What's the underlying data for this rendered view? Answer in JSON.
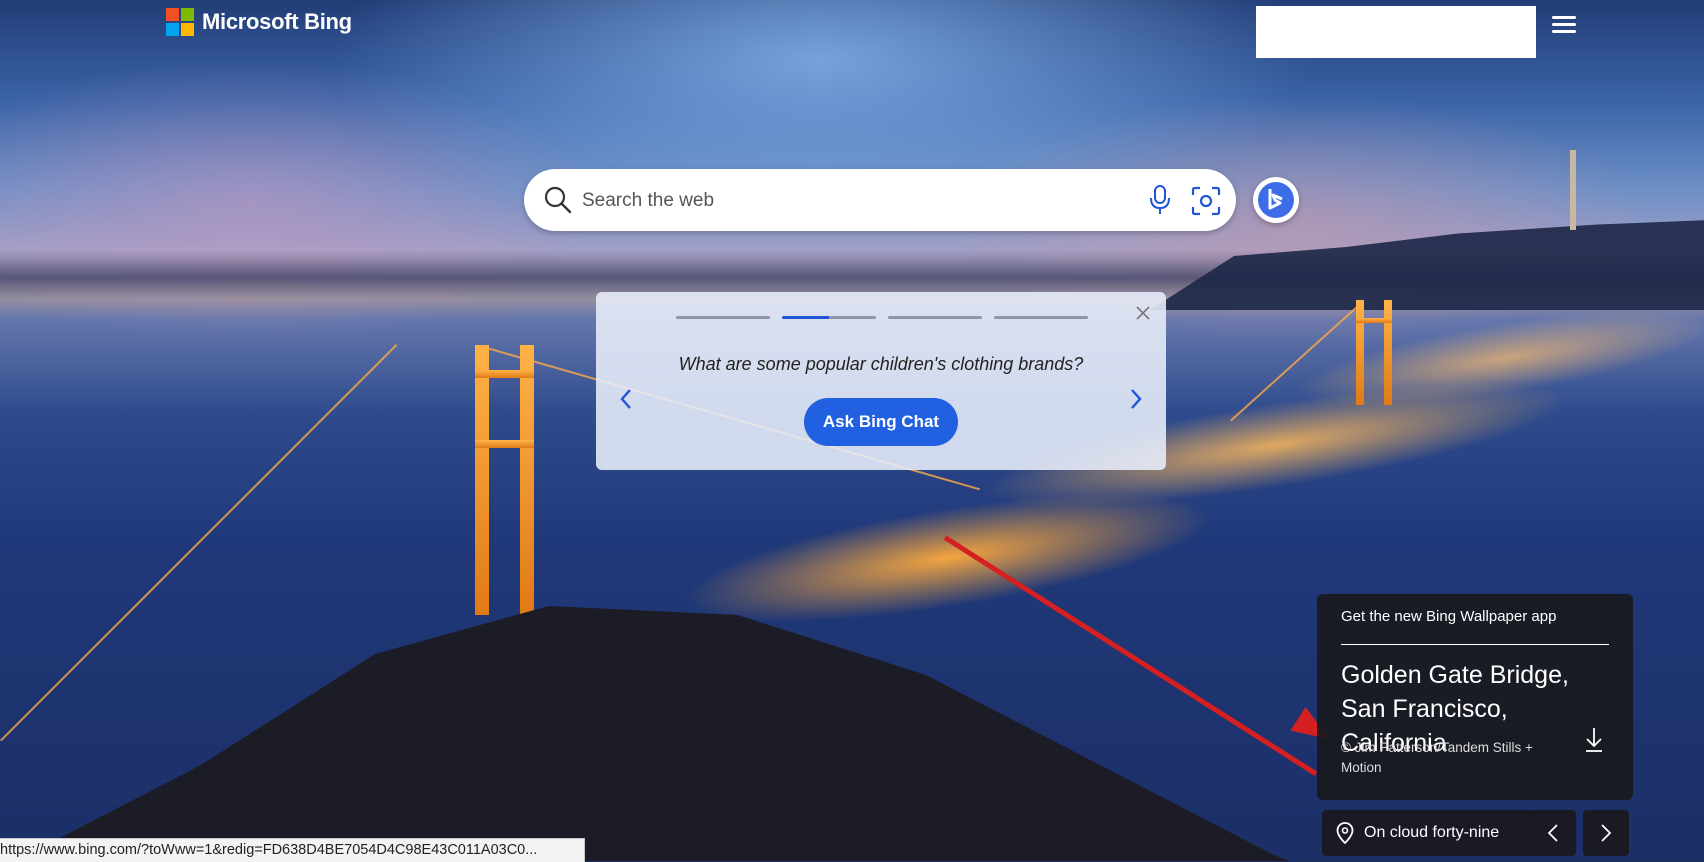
{
  "header": {
    "brand": "Microsoft Bing",
    "brand_colors": [
      "#f25022",
      "#7fba00",
      "#00a4ef",
      "#ffb900"
    ]
  },
  "search": {
    "placeholder": "Search the web",
    "icons": [
      "search-icon",
      "microphone-icon",
      "visual-search-icon"
    ]
  },
  "chat_card": {
    "question": "What are some popular children's clothing brands?",
    "button_label": "Ask Bing Chat",
    "progress_steps": 4,
    "active_step": 2,
    "active_step_fill": 0.5,
    "accent_color": "#2160e0"
  },
  "image_info": {
    "app_link": "Get the new Bing Wallpaper app",
    "title_line1": "Golden Gate Bridge,",
    "title_line2": "San Francisco, California",
    "credit": "© Jim Patterson/Tandem Stills + Motion"
  },
  "bottom_nav": {
    "location_label": "On cloud forty-nine"
  },
  "status_bar": {
    "url": "https://www.bing.com/?toWww=1&redig=FD638D4BE7054D4C98E43C011A03C0..."
  },
  "annotation": {
    "arrow_color": "#d42020"
  }
}
